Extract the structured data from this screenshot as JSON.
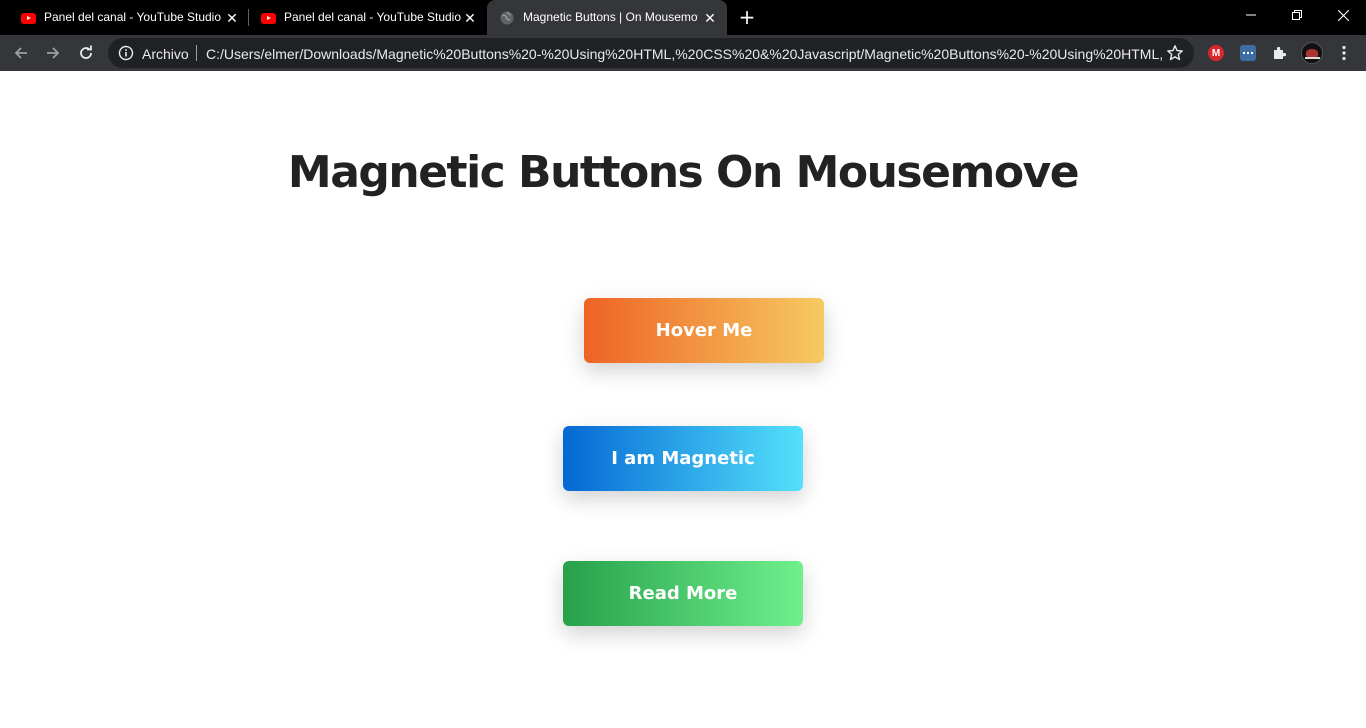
{
  "browser": {
    "tabs": [
      {
        "title": "Panel del canal - YouTube Studio",
        "icon": "youtube-icon",
        "active": false
      },
      {
        "title": "Panel del canal - YouTube Studio",
        "icon": "youtube-icon",
        "active": false
      },
      {
        "title": "Magnetic Buttons | On Mousemove",
        "icon": "globe-icon",
        "active": true
      }
    ],
    "close_glyph": "✕",
    "new_tab_glyph": "+",
    "omnibox": {
      "origin_chip": "Archivo",
      "url": "C:/Users/elmer/Downloads/Magnetic%20Buttons%20-%20Using%20HTML,%20CSS%20&%20Javascript/Magnetic%20Buttons%20-%20Using%20HTML,..."
    },
    "extensions": {
      "mega_label": "M"
    },
    "colors": {
      "tabstrip": "#000000",
      "toolbar": "#35363a",
      "omnibox": "#202124",
      "youtube_red": "#ff0000"
    }
  },
  "page": {
    "title": "Magnetic Buttons On Mousemove",
    "buttons": [
      {
        "label": "Hover Me",
        "gradient": [
          "#ee6324",
          "#f6ca62"
        ]
      },
      {
        "label": "I am Magnetic",
        "gradient": [
          "#0468d4",
          "#54e1fb"
        ]
      },
      {
        "label": "Read More",
        "gradient": [
          "#26a14a",
          "#6ff08d"
        ]
      }
    ],
    "colors": {
      "background": "#ffffff",
      "title_text": "#222222",
      "button_text": "#ffffff"
    }
  }
}
